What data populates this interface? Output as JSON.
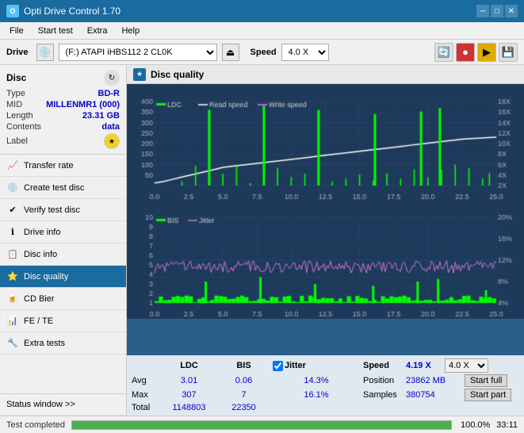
{
  "titleBar": {
    "title": "Opti Drive Control 1.70",
    "icon": "ODC",
    "buttons": [
      "minimize",
      "maximize",
      "close"
    ]
  },
  "menuBar": {
    "items": [
      "File",
      "Start test",
      "Extra",
      "Help"
    ]
  },
  "driveBar": {
    "label": "Drive",
    "driveValue": "(F:)  ATAPI iHBS112  2 CL0K",
    "speedLabel": "Speed",
    "speedValue": "4.0 X"
  },
  "disc": {
    "title": "Disc",
    "type_label": "Type",
    "type_val": "BD-R",
    "mid_label": "MID",
    "mid_val": "MILLENMR1 (000)",
    "length_label": "Length",
    "length_val": "23.31 GB",
    "contents_label": "Contents",
    "contents_val": "data",
    "label_label": "Label"
  },
  "navItems": [
    {
      "id": "transfer-rate",
      "label": "Transfer rate",
      "icon": "📈"
    },
    {
      "id": "create-test-disc",
      "label": "Create test disc",
      "icon": "💿"
    },
    {
      "id": "verify-test-disc",
      "label": "Verify test disc",
      "icon": "✔"
    },
    {
      "id": "drive-info",
      "label": "Drive info",
      "icon": "ℹ"
    },
    {
      "id": "disc-info",
      "label": "Disc info",
      "icon": "📋"
    },
    {
      "id": "disc-quality",
      "label": "Disc quality",
      "icon": "⭐",
      "active": true
    },
    {
      "id": "cd-bier",
      "label": "CD Bier",
      "icon": "🍺"
    },
    {
      "id": "fe-te",
      "label": "FE / TE",
      "icon": "📊"
    },
    {
      "id": "extra-tests",
      "label": "Extra tests",
      "icon": "🔧"
    }
  ],
  "statusWindowLabel": "Status window >>",
  "contentTitle": "Disc quality",
  "chart": {
    "topLegend": [
      "LDC",
      "Read speed",
      "Write speed"
    ],
    "bottomLegend": [
      "BIS",
      "Jitter"
    ],
    "xLabels": [
      "0.0",
      "2.5",
      "5.0",
      "7.5",
      "10.0",
      "12.5",
      "15.0",
      "17.5",
      "20.0",
      "22.5",
      "25.0"
    ],
    "topYLeft": [
      "400",
      "350",
      "300",
      "250",
      "200",
      "150",
      "100",
      "50"
    ],
    "topYRight": [
      "18X",
      "16X",
      "14X",
      "12X",
      "10X",
      "8X",
      "6X",
      "4X",
      "2X"
    ],
    "bottomYLeft": [
      "10",
      "9",
      "8",
      "7",
      "6",
      "5",
      "4",
      "3",
      "2",
      "1"
    ],
    "bottomYRight": [
      "20%",
      "16%",
      "12%",
      "8%",
      "4%"
    ]
  },
  "stats": {
    "col_ldc": "LDC",
    "col_bis": "BIS",
    "col_jitter": "Jitter",
    "col_speed": "Speed",
    "avg_label": "Avg",
    "avg_ldc": "3.01",
    "avg_bis": "0.06",
    "avg_jitter": "14.3%",
    "speed_val": "4.19 X",
    "speed_select": "4.0 X",
    "max_label": "Max",
    "max_ldc": "307",
    "max_bis": "7",
    "max_jitter": "16.1%",
    "position_label": "Position",
    "position_val": "23862 MB",
    "btn_start_full": "Start full",
    "total_label": "Total",
    "total_ldc": "1148803",
    "total_bis": "22350",
    "samples_label": "Samples",
    "samples_val": "380754",
    "btn_start_part": "Start part"
  },
  "statusBar": {
    "text": "Test completed",
    "progress": 100,
    "progressText": "100.0%",
    "time": "33:11"
  }
}
